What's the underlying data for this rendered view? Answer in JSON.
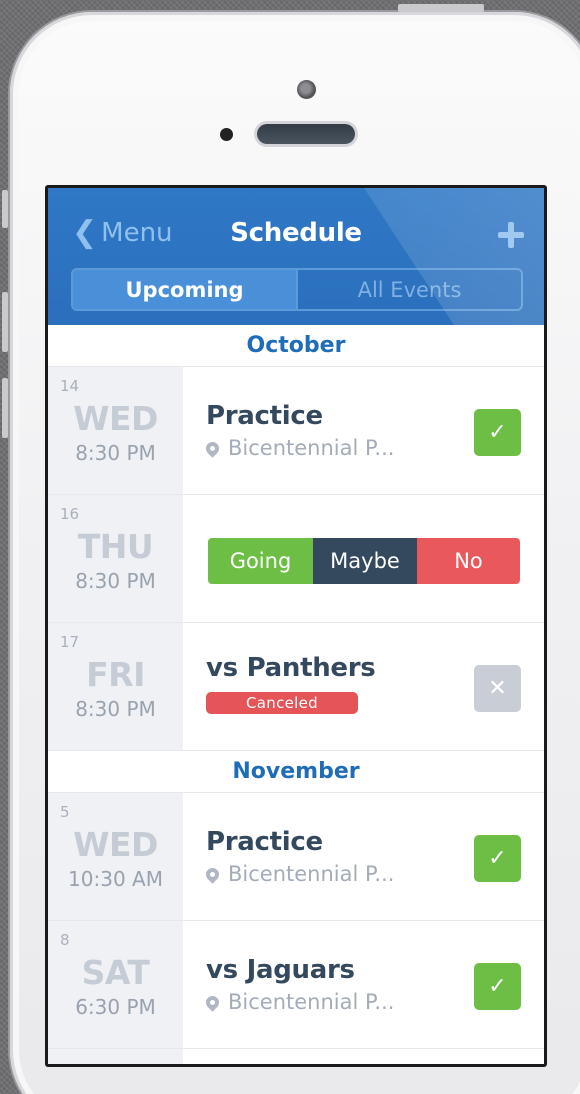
{
  "nav": {
    "back_label": "Menu",
    "title": "Schedule",
    "tabs": [
      {
        "label": "Upcoming",
        "active": true
      },
      {
        "label": "All Events",
        "active": false
      }
    ]
  },
  "months": [
    {
      "name": "October",
      "events": [
        {
          "day_num": "14",
          "weekday": "WED",
          "time": "8:30 PM",
          "title": "Practice",
          "location": "Bicentennial P...",
          "status": "going"
        },
        {
          "day_num": "16",
          "weekday": "THU",
          "time": "8:30 PM",
          "rsvp": {
            "going": "Going",
            "maybe": "Maybe",
            "no": "No"
          }
        },
        {
          "day_num": "17",
          "weekday": "FRI",
          "time": "8:30 PM",
          "title": "vs Panthers",
          "badge": "Canceled",
          "status": "canceled"
        }
      ]
    },
    {
      "name": "November",
      "events": [
        {
          "day_num": "5",
          "weekday": "WED",
          "time": "10:30 AM",
          "title": "Practice",
          "location": "Bicentennial P...",
          "status": "going"
        },
        {
          "day_num": "8",
          "weekday": "SAT",
          "time": "6:30 PM",
          "title": "vs Jaguars",
          "location": "Bicentennial P...",
          "status": "going"
        }
      ]
    }
  ],
  "colors": {
    "nav": "#2f78c6",
    "going": "#6cbf44",
    "maybe": "#35495e",
    "no": "#e9595b",
    "month": "#1f6cb7"
  },
  "icons": {
    "back": "chevron-left-icon",
    "add": "plus-icon",
    "location": "map-pin-icon",
    "check": "check-icon",
    "cancel": "x-icon"
  }
}
